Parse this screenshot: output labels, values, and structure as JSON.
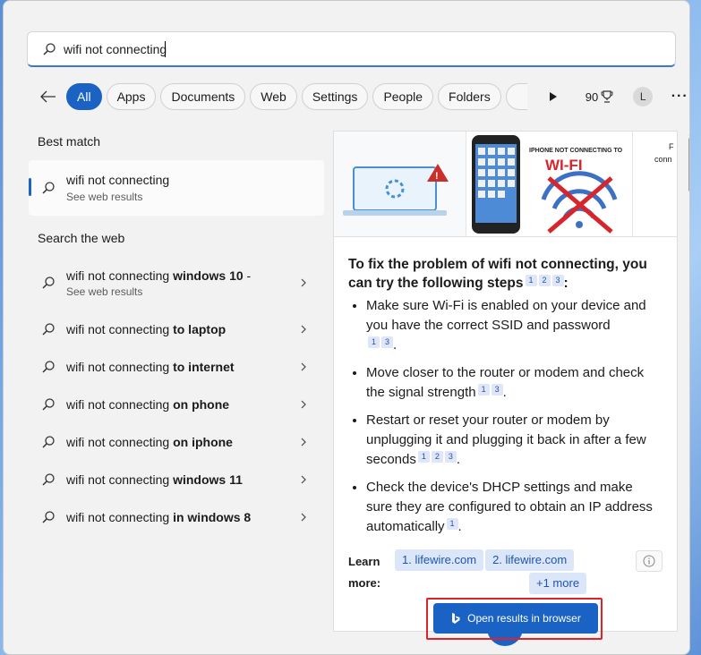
{
  "search": {
    "value": "wifi not connecting"
  },
  "filters": {
    "items": [
      "All",
      "Apps",
      "Documents",
      "Web",
      "Settings",
      "People",
      "Folders"
    ],
    "active": "All",
    "points": "90"
  },
  "user": {
    "initial": "L"
  },
  "left": {
    "best_match_title": "Best match",
    "best_match": {
      "main": "wifi not connecting",
      "sub": "See web results"
    },
    "search_web_title": "Search the web",
    "results": [
      {
        "base": "wifi not connecting ",
        "bold": "windows 10",
        "tail": " -",
        "sub": "See web results"
      },
      {
        "base": "wifi not connecting ",
        "bold": "to laptop",
        "tail": "",
        "sub": ""
      },
      {
        "base": "wifi not connecting ",
        "bold": "to internet",
        "tail": "",
        "sub": ""
      },
      {
        "base": "wifi not connecting ",
        "bold": "on phone",
        "tail": "",
        "sub": ""
      },
      {
        "base": "wifi not connecting ",
        "bold": "on iphone",
        "tail": "",
        "sub": ""
      },
      {
        "base": "wifi not connecting ",
        "bold": "windows 11",
        "tail": "",
        "sub": ""
      },
      {
        "base": "wifi not connecting ",
        "bold": "in windows 8",
        "tail": "",
        "sub": ""
      }
    ]
  },
  "answer": {
    "image_caption_1": "IPHONE NOT CONNECTING TO",
    "image_caption_2": "WI-FI",
    "image_caption_3a": "F",
    "image_caption_3b": "conn",
    "heading": "To fix the problem of wifi not connecting, you can try the following steps",
    "heading_cites": [
      "1",
      "2",
      "3"
    ],
    "heading_tail": ":",
    "bullets": [
      {
        "text": "Make sure Wi-Fi is enabled on your device and you have the correct SSID and password",
        "cites": [
          "1",
          "3"
        ]
      },
      {
        "text": "Move closer to the router or modem and check the signal strength",
        "cites": [
          "1",
          "3"
        ]
      },
      {
        "text": "Restart or reset your router or modem by unplugging it and plugging it back in after a few seconds",
        "cites": [
          "1",
          "2",
          "3"
        ]
      },
      {
        "text": "Check the device's DHCP settings and make sure they are configured to obtain an IP address automatically",
        "cites": [
          "1"
        ]
      }
    ],
    "learn_label_1": "Learn",
    "learn_label_2": "more:",
    "learn_links": [
      "1. lifewire.com",
      "2. lifewire.com"
    ],
    "learn_more": "+1 more",
    "open_button": "Open results in browser"
  },
  "colors": {
    "accent": "#1a63c5",
    "highlight_frame": "#e1202a"
  }
}
